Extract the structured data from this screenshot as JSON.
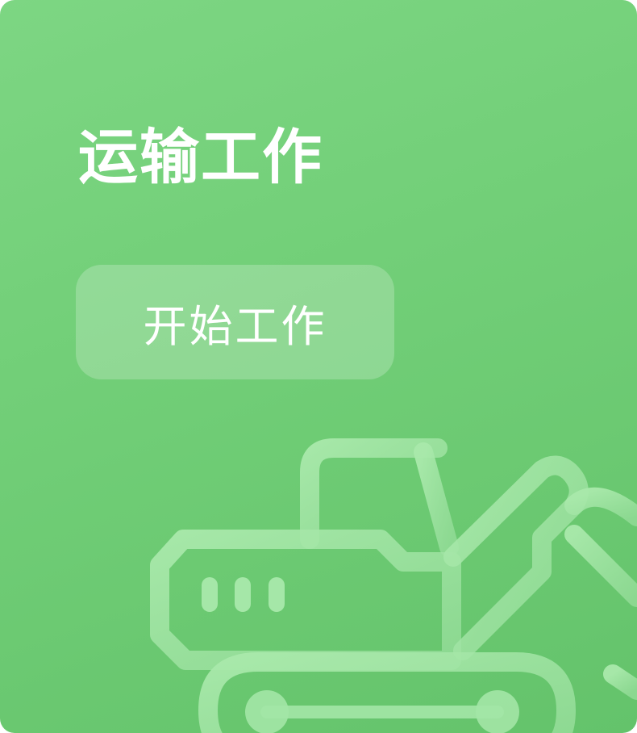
{
  "card": {
    "title": "运输工作",
    "start_button_label": "开始工作",
    "illustration_icon": "excavator-icon"
  },
  "colors": {
    "card_gradient_start": "#7dd683",
    "card_gradient_end": "#64c36b",
    "text": "#ffffff"
  }
}
